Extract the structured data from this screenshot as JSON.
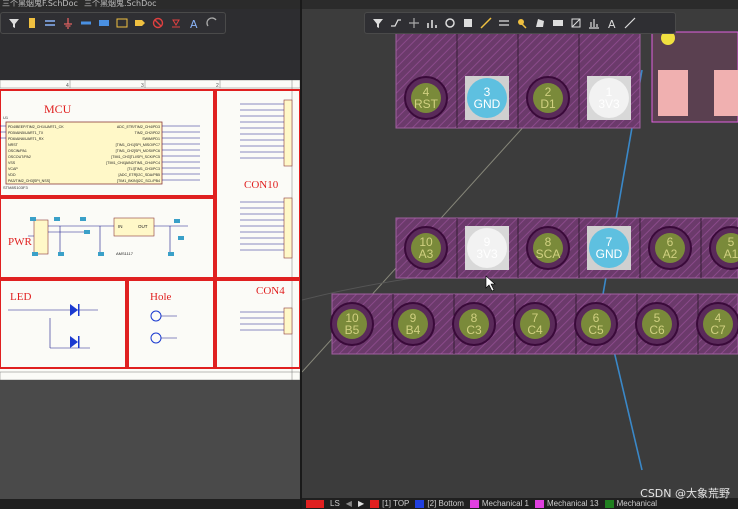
{
  "left_pane": {
    "tab_1": "三个黑烟鬼F.SchDoc",
    "tab_2": "三个黑烟鬼.SchDoc",
    "sections": {
      "mcu_title": "MCU",
      "con10_title": "CON10",
      "pwr_title": "PWR",
      "led_title": "LED",
      "hole_title": "Hole",
      "con4_title": "CON4"
    },
    "mcu_chip": {
      "ref": "U1",
      "part": "STM8S103F3",
      "left_pins": [
        "PD6/AIN6/UART1_RX",
        "PD5/AIN5/UART1_TX",
        "PD4/BEEP/TIM2_CH1/UART1_CK",
        "NRST",
        "OSCIN/PA1",
        "OSCOUT/PA2",
        "VSS",
        "VCAP",
        "VDD",
        "PA3/TIM2_CH3[SPI_NSS]"
      ],
      "right_pins": [
        "ADC_ETR/TIM2_CH4/PD3",
        "TIM2_CH2/PD2",
        "SWIM/PD1",
        "[TIM1_CH1]SPI_MISO/PC7",
        "[TIM1_CH2]SPI_MOSI/PC6",
        "[TIM1_CH3]TLI/SPI_SCK/PC5",
        "[TIM1_CH4]AIN2/TIM1_CH4/PC4",
        "[TLI]TIM1_CH3/PC3",
        "[ADC_ETR]I2C_SDA/PB5",
        "[TIM1_BKIN]I2C_SCL/PB4"
      ]
    },
    "pwr": {
      "ic_label": "AMS1117",
      "in": "IN",
      "out": "OUT"
    },
    "border_numbers": [
      "1",
      "2",
      "3",
      "4"
    ]
  },
  "right_pane": {
    "top_row_pads": [
      {
        "num": "4",
        "net": "RST"
      },
      {
        "num": "3",
        "net": "GND"
      },
      {
        "num": "2",
        "net": "D1"
      },
      {
        "num": "1",
        "net": "3V3"
      }
    ],
    "mid_row_pads": [
      {
        "num": "10",
        "net": "A3"
      },
      {
        "num": "9",
        "net": "3V3"
      },
      {
        "num": "8",
        "net": "SCA"
      },
      {
        "num": "7",
        "net": "GND"
      },
      {
        "num": "6",
        "net": "A2"
      },
      {
        "num": "5",
        "net": "A1"
      }
    ],
    "bottom_row_pads": [
      {
        "num": "10",
        "net": "B5"
      },
      {
        "num": "9",
        "net": "B4"
      },
      {
        "num": "8",
        "net": "C3"
      },
      {
        "num": "7",
        "net": "C4"
      },
      {
        "num": "6",
        "net": "C5"
      },
      {
        "num": "5",
        "net": "C6"
      },
      {
        "num": "4",
        "net": "C7"
      }
    ],
    "layers": [
      {
        "name": "[1] TOP",
        "color": "#e02020"
      },
      {
        "name": "[2] Bottom",
        "color": "#2040e0"
      },
      {
        "name": "Mechanical 1",
        "color": "#e040e0"
      },
      {
        "name": "Mechanical 13",
        "color": "#e040e0"
      },
      {
        "name": "Mechanical",
        "color": "#208020"
      }
    ],
    "status_ls": "LS"
  },
  "watermark": "CSDN @大象荒野"
}
